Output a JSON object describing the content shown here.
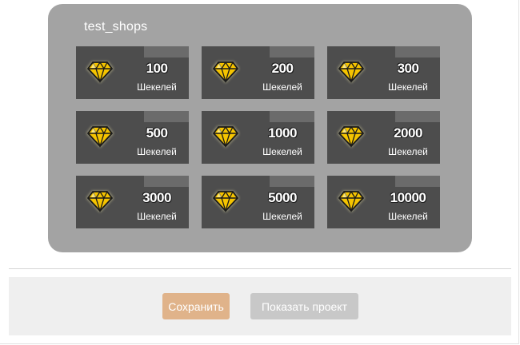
{
  "shop": {
    "title": "test_shops",
    "items": [
      {
        "amount": "100",
        "currency": "Шекелей",
        "icon": "diamond-icon"
      },
      {
        "amount": "200",
        "currency": "Шекелей",
        "icon": "diamond-icon"
      },
      {
        "amount": "300",
        "currency": "Шекелей",
        "icon": "diamond-icon"
      },
      {
        "amount": "500",
        "currency": "Шекелей",
        "icon": "diamond-icon"
      },
      {
        "amount": "1000",
        "currency": "Шекелей",
        "icon": "diamond-icon"
      },
      {
        "amount": "2000",
        "currency": "Шекелей",
        "icon": "diamond-icon"
      },
      {
        "amount": "3000",
        "currency": "Шекелей",
        "icon": "diamond-icon"
      },
      {
        "amount": "5000",
        "currency": "Шекелей",
        "icon": "diamond-icon"
      },
      {
        "amount": "10000",
        "currency": "Шекелей",
        "icon": "diamond-icon"
      }
    ]
  },
  "footer": {
    "save_label": "Сохранить",
    "show_project_label": "Показать проект"
  },
  "colors": {
    "panel_bg": "#a3a3a3",
    "card_bg": "#4d4d4d",
    "diamond": "#f5c400",
    "save_button": "#e0b38a",
    "show_button": "#c8c8c8"
  }
}
